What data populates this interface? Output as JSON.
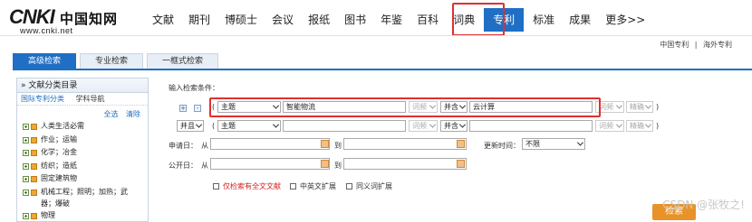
{
  "logo": {
    "text": "CNKI",
    "cn": "中国知网",
    "url": "www.cnki.net"
  },
  "nav": {
    "items": [
      "文献",
      "期刊",
      "博硕士",
      "会议",
      "报纸",
      "图书",
      "年鉴",
      "百科",
      "词典",
      "专利",
      "标准",
      "成果",
      "更多>>"
    ],
    "active": "专利"
  },
  "top_links": {
    "left": "中国专利",
    "sep": "|",
    "right": "海外专利"
  },
  "tabs": [
    "高级检索",
    "专业检索",
    "一框式检索"
  ],
  "sidebar": {
    "title": "文献分类目录",
    "sub_tabs": [
      "国际专利分类",
      "学科导航"
    ],
    "select_all": "全选",
    "clear": "清除",
    "items": [
      "人类生活必需",
      "作业；运输",
      "化学；冶金",
      "纺织；造纸",
      "固定建筑物",
      "机械工程；照明；加热；武器；爆破",
      "物理"
    ]
  },
  "form": {
    "heading": "输入检索条件：",
    "row1": {
      "lparen": "(",
      "field": "主题",
      "value": "智能物流",
      "match1": "词频",
      "op": "并含",
      "value2": "云计算",
      "match2": "词频",
      "precision": "精确",
      "rparen": ")"
    },
    "row2": {
      "logic": "并且",
      "lparen": "(",
      "field": "主题",
      "match1": "词频",
      "op": "并含",
      "match2": "词频",
      "precision": "精确",
      "rparen": ")"
    },
    "apply_date": {
      "label": "申请日：",
      "from": "从",
      "to": "到"
    },
    "update_time": {
      "label": "更新时间：",
      "value": "不限"
    },
    "pub_date": {
      "label": "公开日：",
      "from": "从",
      "to": "到"
    },
    "options": [
      "仅检索有全文文献",
      "中英文扩展",
      "同义词扩展"
    ],
    "plus": "+",
    "minus": "-"
  },
  "search_button": "检索",
  "watermark": "CSDN @张牧之!",
  "colors": {
    "accent": "#1f6fc4",
    "highlight": "#e03030",
    "search": "#e8922a"
  }
}
